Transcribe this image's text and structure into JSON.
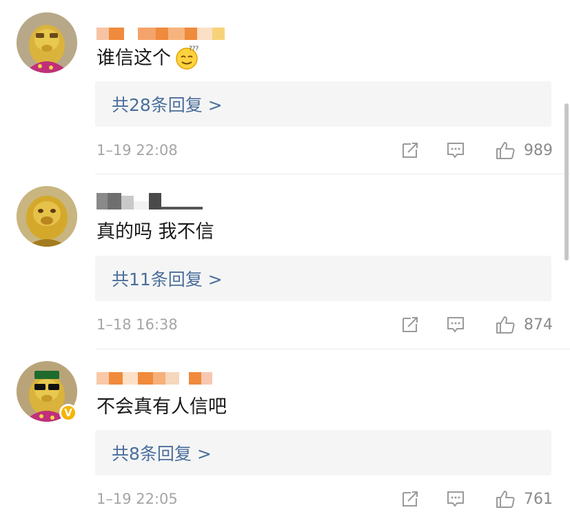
{
  "comments": [
    {
      "text": "谁信这个",
      "emoji": "thinking-smile-emoji",
      "replies": "共28条回复 >",
      "time": "1–19 22:08",
      "likes": "989",
      "verified": false
    },
    {
      "text": "真的吗 我不信",
      "replies": "共11条回复 >",
      "time": "1–18 16:38",
      "likes": "874",
      "verified": false
    },
    {
      "text": "不会真有人信吧",
      "replies": "共8条回复 >",
      "time": "1–19 22:05",
      "likes": "761",
      "verified": true
    }
  ],
  "icons": {
    "share": "share-icon",
    "comment": "comment-icon",
    "like": "thumbs-up-icon"
  },
  "colors": {
    "link": "#4a6e9c",
    "meta": "#a5a5a5",
    "reply_bg": "#f5f5f5",
    "username_blur_orange": "#f08a3c",
    "username_blur_gray": "#707070",
    "verified_badge": "#f4b400"
  }
}
